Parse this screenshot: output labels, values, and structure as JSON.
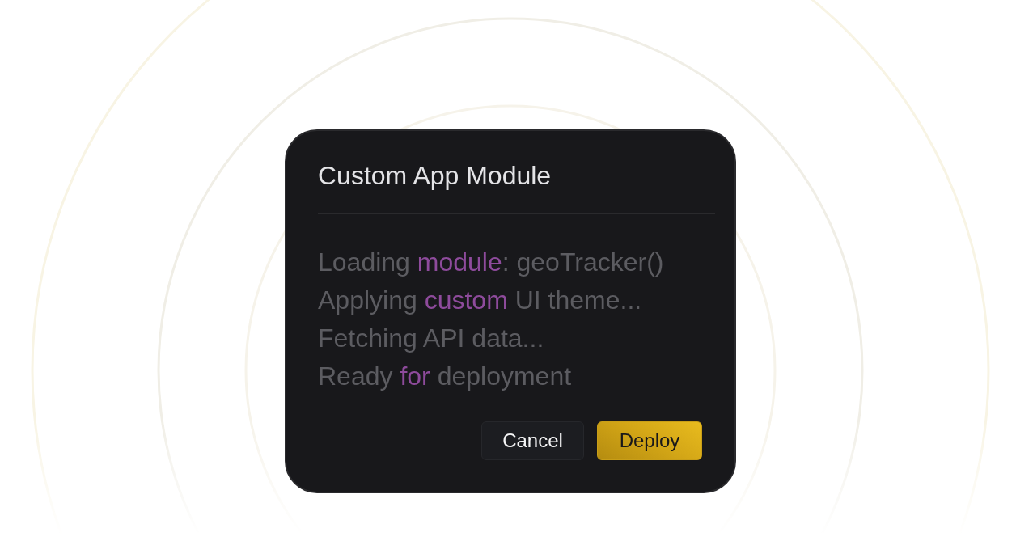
{
  "dialog": {
    "title": "Custom App Module",
    "log_lines": [
      {
        "parts": [
          {
            "text": "Loading ",
            "highlight": false
          },
          {
            "text": "module",
            "highlight": true
          },
          {
            "text": ": geoTracker()",
            "highlight": false
          }
        ]
      },
      {
        "parts": [
          {
            "text": "Applying ",
            "highlight": false
          },
          {
            "text": "custom",
            "highlight": true
          },
          {
            "text": " UI theme...",
            "highlight": false
          }
        ]
      },
      {
        "parts": [
          {
            "text": "Fetching API data...",
            "highlight": false
          }
        ]
      },
      {
        "parts": [
          {
            "text": "Ready ",
            "highlight": false
          },
          {
            "text": "for",
            "highlight": true
          },
          {
            "text": " deployment",
            "highlight": false
          }
        ]
      }
    ],
    "buttons": [
      {
        "label": "Cancel",
        "kind": "secondary"
      },
      {
        "label": "Deploy",
        "kind": "primary"
      }
    ]
  }
}
